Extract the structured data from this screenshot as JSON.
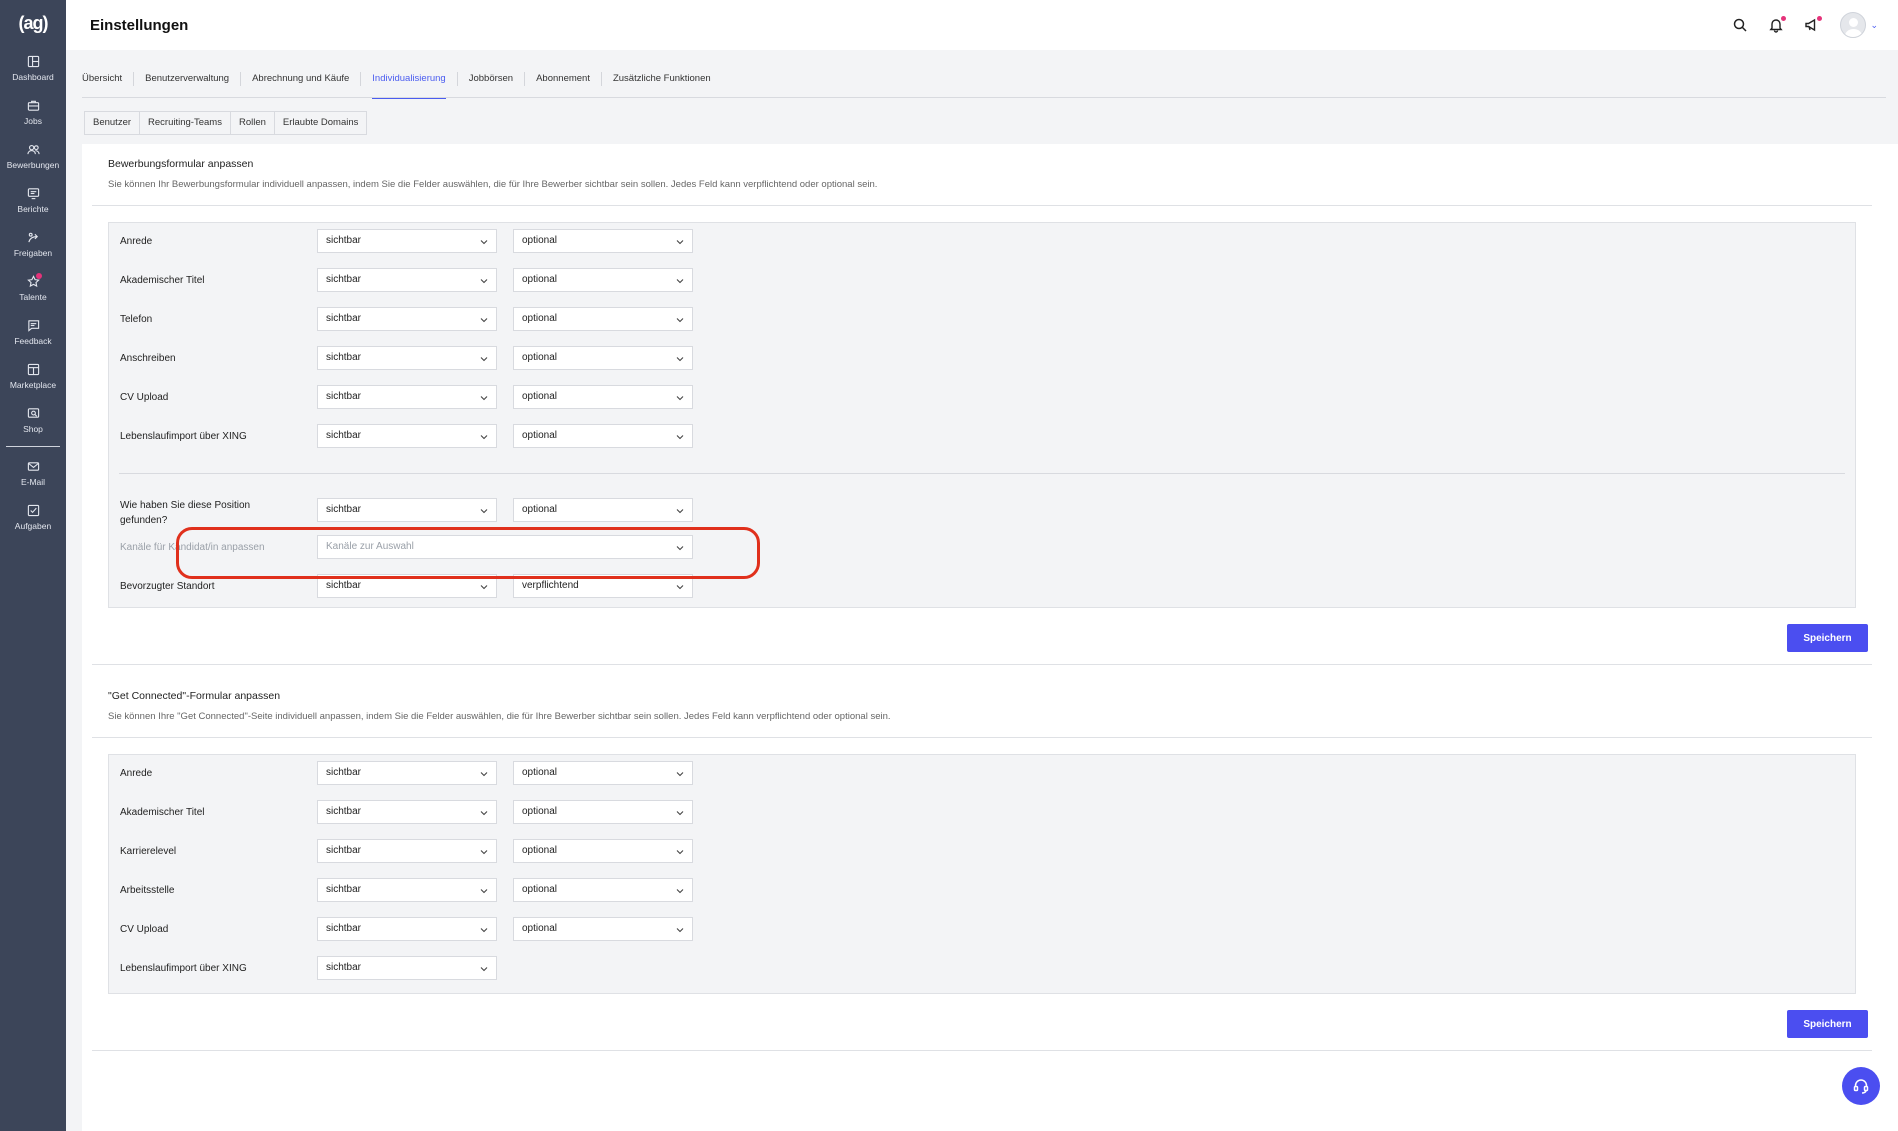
{
  "app": {
    "logo_text": "(ag)",
    "page_title": "Einstellungen"
  },
  "sidebar": {
    "items": [
      {
        "label": "Dashboard",
        "icon": "dashboard-icon"
      },
      {
        "label": "Jobs",
        "icon": "briefcase-icon"
      },
      {
        "label": "Bewerbungen",
        "icon": "users-icon"
      },
      {
        "label": "Berichte",
        "icon": "report-icon"
      },
      {
        "label": "Freigaben",
        "icon": "share-icon"
      },
      {
        "label": "Talente",
        "icon": "star-icon"
      },
      {
        "label": "Feedback",
        "icon": "chat-icon"
      },
      {
        "label": "Marketplace",
        "icon": "marketplace-icon"
      },
      {
        "label": "Shop",
        "icon": "shop-icon"
      }
    ],
    "bottom_items": [
      {
        "label": "E-Mail",
        "icon": "mail-icon"
      },
      {
        "label": "Aufgaben",
        "icon": "task-icon"
      }
    ]
  },
  "tabs": [
    "Übersicht",
    "Benutzerverwaltung",
    "Abrechnung und Käufe",
    "Individualisierung",
    "Jobbörsen",
    "Abonnement",
    "Zusätzliche Funktionen"
  ],
  "active_tab": "Individualisierung",
  "subtabs": [
    "Benutzer",
    "Recruiting-Teams",
    "Rollen",
    "Erlaubte Domains"
  ],
  "section1": {
    "title": "Bewerbungsformular anpassen",
    "description": "Sie können Ihr Bewerbungsformular individuell anpassen, indem Sie die Felder auswählen, die für Ihre Bewerber sichtbar sein sollen. Jedes Feld kann verpflichtend oder optional sein.",
    "rows": [
      {
        "label": "Anrede",
        "visibility": "sichtbar",
        "requirement": "optional"
      },
      {
        "label": "Akademischer Titel",
        "visibility": "sichtbar",
        "requirement": "optional"
      },
      {
        "label": "Telefon",
        "visibility": "sichtbar",
        "requirement": "optional"
      },
      {
        "label": "Anschreiben",
        "visibility": "sichtbar",
        "requirement": "optional"
      },
      {
        "label": "CV Upload",
        "visibility": "sichtbar",
        "requirement": "optional"
      },
      {
        "label": "Lebenslaufimport über XING",
        "visibility": "sichtbar",
        "requirement": "optional"
      }
    ],
    "position_row": {
      "label": "Wie haben Sie diese Position gefunden?",
      "visibility": "sichtbar",
      "requirement": "optional"
    },
    "channels_row": {
      "label": "Kanäle für Kandidat/in anpassen",
      "placeholder": "Kanäle zur Auswahl"
    },
    "location_row": {
      "label": "Bevorzugter Standort",
      "visibility": "sichtbar",
      "requirement": "verpflichtend"
    },
    "save_label": "Speichern"
  },
  "section2": {
    "title": "\"Get Connected\"-Formular anpassen",
    "description": "Sie können Ihre \"Get Connected\"-Seite individuell anpassen, indem Sie die Felder auswählen, die für Ihre Bewerber sichtbar sein sollen. Jedes Feld kann verpflichtend oder optional sein.",
    "rows": [
      {
        "label": "Anrede",
        "visibility": "sichtbar",
        "requirement": "optional"
      },
      {
        "label": "Akademischer Titel",
        "visibility": "sichtbar",
        "requirement": "optional"
      },
      {
        "label": "Karrierelevel",
        "visibility": "sichtbar",
        "requirement": "optional"
      },
      {
        "label": "Arbeitsstelle",
        "visibility": "sichtbar",
        "requirement": "optional"
      },
      {
        "label": "CV Upload",
        "visibility": "sichtbar",
        "requirement": "optional"
      },
      {
        "label": "Lebenslaufimport über XING",
        "visibility": "sichtbar",
        "requirement": null
      }
    ],
    "save_label": "Speichern"
  },
  "colors": {
    "accent": "#4b4ef0",
    "sidebar_bg": "#3c4559",
    "highlight": "#e0301c",
    "notification": "#e5337a"
  }
}
